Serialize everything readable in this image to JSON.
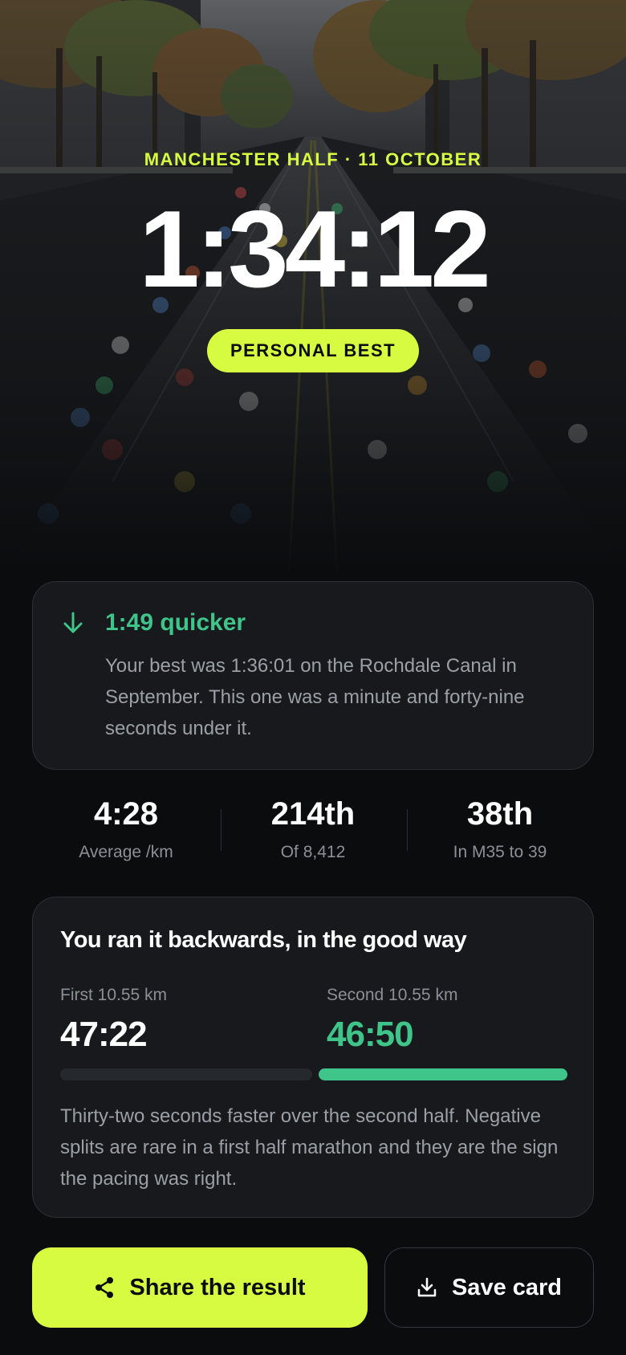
{
  "race": {
    "meta": "MANCHESTER HALF · 11 OCTOBER",
    "finish_time": "1:34:12",
    "badge": "PERSONAL BEST"
  },
  "pb_card": {
    "icon": "arrow-down-icon",
    "headline": "1:49 quicker",
    "body": "Your best was 1:36:01 on the Rochdale Canal in September. This one was a minute and forty-nine seconds under it."
  },
  "stats": [
    {
      "value": "4:28",
      "label": "Average /km"
    },
    {
      "value": "214th",
      "label": "Of 8,412"
    },
    {
      "value": "38th",
      "label": "In M35 to 39"
    }
  ],
  "splits": {
    "title": "You ran it backwards, in the good way",
    "first": {
      "label": "First 10.55 km",
      "value": "47:22"
    },
    "second": {
      "label": "Second 10.55 km",
      "value": "46:50"
    },
    "note": "Thirty-two seconds faster over the second half. Negative splits are rare in a first half marathon and they are the sign the pacing was right."
  },
  "actions": {
    "share": {
      "label": "Share the result",
      "icon": "share-icon"
    },
    "save": {
      "label": "Save card",
      "icon": "download-icon"
    }
  },
  "colors": {
    "accent": "#d6fb41",
    "positive": "#3fc48a",
    "background": "#0b0c0e",
    "card": "#17191c"
  }
}
